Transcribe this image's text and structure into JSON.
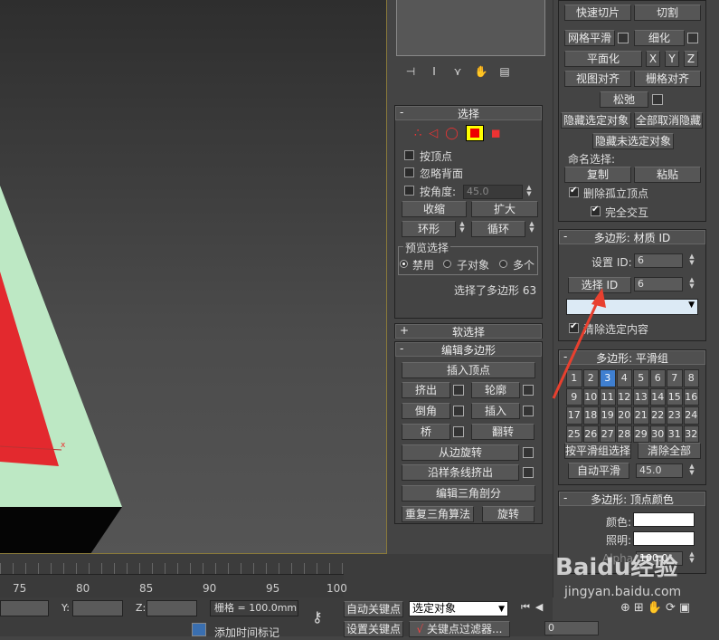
{
  "viewport": {
    "axis_label": "x"
  },
  "mid": {
    "icons": [
      "pin-icon",
      "modifier-stack-icon",
      "funnel-icon",
      "hand-icon",
      "configure-icon"
    ],
    "select": {
      "title": "选择",
      "by_vertex": "按顶点",
      "ignore_backface": "忽略背面",
      "by_angle": "按角度:",
      "angle_value": "45.0",
      "shrink": "收缩",
      "grow": "扩大",
      "ring": "环形",
      "loop": "循环",
      "preview_title": "预览选择",
      "preview_off": "禁用",
      "preview_sub": "子对象",
      "preview_multi": "多个",
      "status": "选择了多边形 63"
    },
    "soft_title": "软选择",
    "edit_poly": {
      "title": "编辑多边形",
      "insert_vertex": "插入顶点",
      "extrude": "挤出",
      "outline": "轮廓",
      "bevel": "倒角",
      "inset": "插入",
      "bridge": "桥",
      "flip": "翻转",
      "hinge": "从边旋转",
      "extrude_spline": "沿样条线挤出",
      "edit_tri": "编辑三角剖分",
      "retri": "重复三角算法",
      "turn": "旋转"
    }
  },
  "right": {
    "quickslice": "快速切片",
    "cut": "切割",
    "msmooth": "网格平滑",
    "tessellate": "细化",
    "make_planar": "平面化",
    "x": "X",
    "y": "Y",
    "z": "Z",
    "view_align": "视图对齐",
    "grid_align": "栅格对齐",
    "relax": "松弛",
    "hide_sel": "隐藏选定对象",
    "unhide_all": "全部取消隐藏",
    "hide_unsel": "隐藏未选定对象",
    "named_sel": "命名选择:",
    "copy": "复制",
    "paste": "粘贴",
    "del_iso": "删除孤立顶点",
    "full_interact": "完全交互",
    "matid": {
      "title": "多边形: 材质 ID",
      "set_id": "设置 ID:",
      "set_val": "6",
      "select_id": "选择 ID",
      "sel_val": "6",
      "clear_sel": "清除选定内容"
    },
    "smooth": {
      "title": "多边形: 平滑组",
      "groups": [
        "1",
        "2",
        "3",
        "4",
        "5",
        "6",
        "7",
        "8",
        "9",
        "10",
        "11",
        "12",
        "13",
        "14",
        "15",
        "16",
        "17",
        "18",
        "19",
        "20",
        "21",
        "22",
        "23",
        "24",
        "25",
        "26",
        "27",
        "28",
        "29",
        "30",
        "31",
        "32"
      ],
      "selected": "3",
      "select_by": "按平滑组选择",
      "clear_all": "清除全部",
      "auto_smooth": "自动平滑",
      "auto_val": "45.0"
    },
    "vcolor": {
      "title": "多边形: 顶点颜色",
      "color": "颜色:",
      "illum": "照明:",
      "alpha": "Alpha:",
      "alpha_val": "100.0"
    }
  },
  "bottom": {
    "ticks": [
      "75",
      "80",
      "85",
      "90",
      "95",
      "100"
    ],
    "y_label": "Y:",
    "z_label": "Z:",
    "grid_text": "栅格 = 100.0mm",
    "auto_key": "自动关键点",
    "set_key": "设置关键点",
    "sel_obj": "选定对象",
    "key_filter": "关键点过滤器...",
    "add_time_tag": "添加时间标记",
    "frame": "0"
  },
  "watermark": "Baidu经验",
  "watermark_url": "jingyan.baidu.com"
}
